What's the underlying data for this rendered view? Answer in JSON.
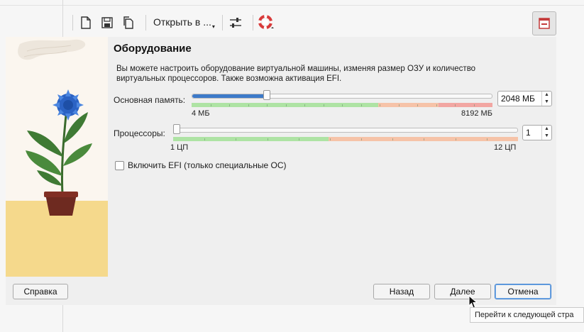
{
  "toolbar": {
    "open_in_label": "Открыть в ...",
    "icons": [
      "new-file-icon",
      "save-icon",
      "copy-icon",
      "sliders-icon",
      "lifebuoy-icon",
      "help-icon"
    ]
  },
  "wizard": {
    "title": "Оборудование",
    "description": "Вы можете настроить оборудование виртуальной машины, изменяя размер ОЗУ и количество виртуальных процессоров. Также возможна активация EFI.",
    "memory": {
      "label": "Основная память:",
      "min_label": "4 МБ",
      "max_label": "8192 МБ",
      "value": "2048 МБ",
      "fraction": 0.25
    },
    "processors": {
      "label": "Процессоры:",
      "min_label": "1 ЦП",
      "max_label": "12 ЦП",
      "value": "1",
      "fraction": 0.0
    },
    "efi": {
      "label": "Включить EFI (только специальные ОС)",
      "checked": false
    },
    "buttons": {
      "help": "Справка",
      "back": "Назад",
      "next": "Далее",
      "cancel": "Отмена"
    }
  },
  "tooltip": "Перейти к следующей стра",
  "colors": {
    "accent": "#3d7ac9",
    "bar_green": "#aee3a4",
    "bar_orange": "#f6c3a8",
    "bar_red": "#f2a6a2",
    "background_yellow": "#f5d98c"
  }
}
